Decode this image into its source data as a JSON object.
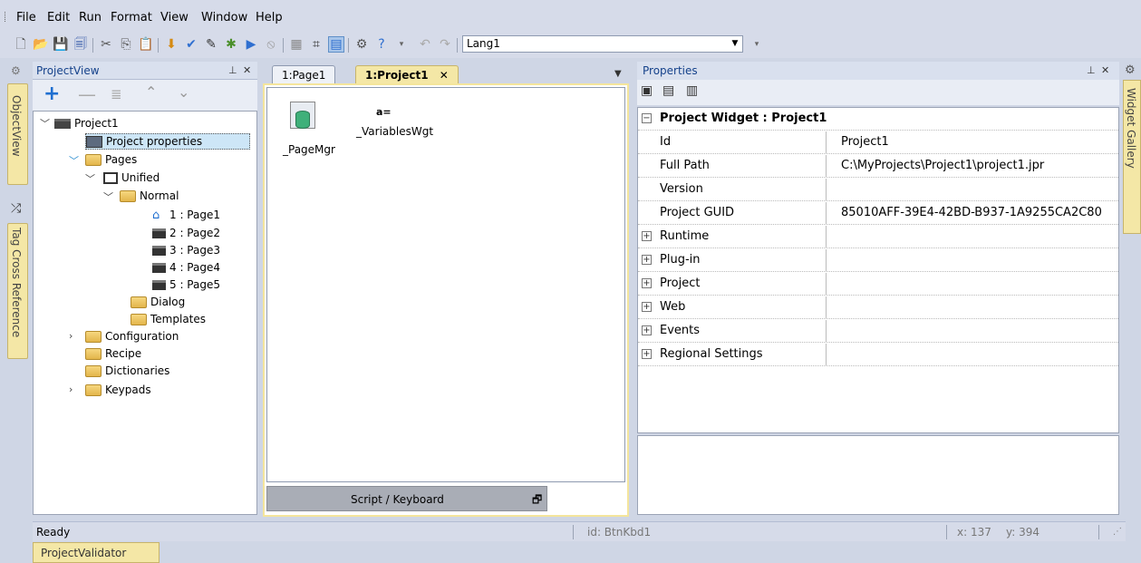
{
  "menu": [
    "File",
    "Edit",
    "Run",
    "Format",
    "View",
    "Window",
    "Help"
  ],
  "toolbar": {
    "language": "Lang1"
  },
  "left_tabs": {
    "object_view": "ObjectView",
    "tag_xref": "Tag Cross Reference"
  },
  "right_tabs": {
    "widget_gallery": "Widget Gallery"
  },
  "project_view": {
    "title": "ProjectView",
    "tree": {
      "project": "Project1",
      "project_properties": "Project properties",
      "pages": "Pages",
      "unified": "Unified",
      "normal": "Normal",
      "page_items": [
        "1 : Page1",
        "2 : Page2",
        "3 : Page3",
        "4 : Page4",
        "5 : Page5"
      ],
      "dialog": "Dialog",
      "templates": "Templates",
      "configuration": "Configuration",
      "recipe": "Recipe",
      "dictionaries": "Dictionaries",
      "keypads": "Keypads"
    }
  },
  "editor": {
    "tabs": [
      "1:Page1",
      "1:Project1"
    ],
    "widgets": {
      "page_mgr": "_PageMgr",
      "variables_glyph": "a=",
      "variables": "_VariablesWgt"
    },
    "script_bar": "Script / Keyboard"
  },
  "properties": {
    "title": "Properties",
    "header": "Project Widget : Project1",
    "rows": [
      {
        "name": "Id",
        "value": "Project1"
      },
      {
        "name": "Full Path",
        "value": "C:\\MyProjects\\Project1\\project1.jpr"
      },
      {
        "name": "Version",
        "value": ""
      },
      {
        "name": "Project GUID",
        "value": "85010AFF-39E4-42BD-B937-1A9255CA2C80"
      }
    ],
    "groups": [
      "Runtime",
      "Plug-in",
      "Project",
      "Web",
      "Events",
      "Regional Settings"
    ]
  },
  "status": {
    "ready": "Ready",
    "id": "id: BtnKbd1",
    "x": "x: 137",
    "y": "y: 394"
  },
  "bottom_tab": "ProjectValidator",
  "colors": {
    "accent_title": "#15428b",
    "tab_yellow": "#f4e7a6",
    "selection": "#cde6f7"
  }
}
